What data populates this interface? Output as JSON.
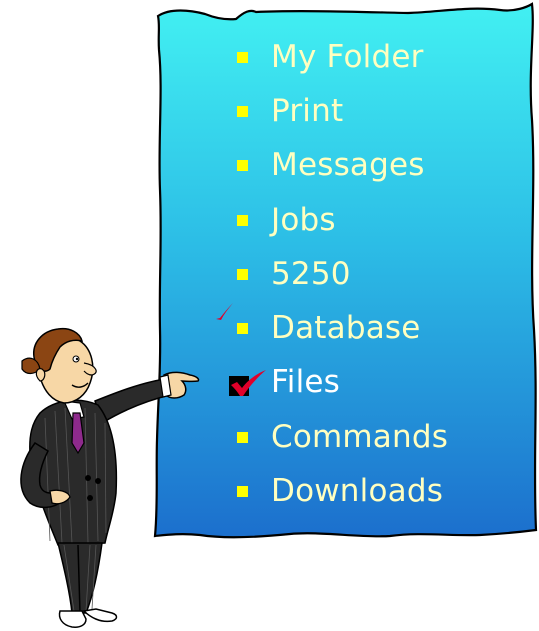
{
  "menu": {
    "items": [
      {
        "label": "My Folder",
        "marker": "square-bullet"
      },
      {
        "label": "Print",
        "marker": "square-bullet"
      },
      {
        "label": "Messages",
        "marker": "square-bullet"
      },
      {
        "label": "Jobs",
        "marker": "square-bullet"
      },
      {
        "label": "5250",
        "marker": "square-bullet"
      },
      {
        "label": "Database",
        "marker": "square-bullet"
      },
      {
        "label": "Files",
        "marker": "checkmark",
        "selected": true
      },
      {
        "label": "Commands",
        "marker": "square-bullet"
      },
      {
        "label": "Downloads",
        "marker": "square-bullet"
      }
    ]
  },
  "colors": {
    "board_top": "#38e8ef",
    "board_bottom": "#1f78d0",
    "bullet": "#ffff00",
    "label_text": "#ffffc0",
    "checkmark": "#e0002a",
    "suit": "#2a2a2a",
    "tie": "#8e2a8c"
  },
  "icons": {
    "bullet": "square-bullet-icon",
    "selected": "red-checkmark-icon",
    "presenter": "businessman-pointing-illustration"
  }
}
